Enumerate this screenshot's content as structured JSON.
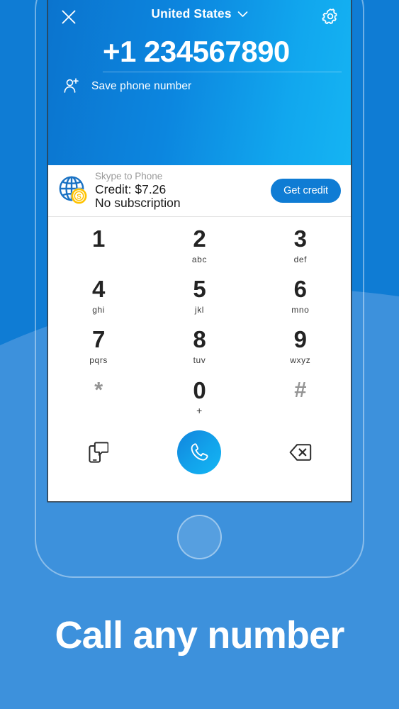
{
  "background": {
    "dark_blue": "#0F7CD4",
    "light_blue": "#3D91DC"
  },
  "phone": {
    "home_button_name": "home-button"
  },
  "app": {
    "header": {
      "close_icon": "close-icon",
      "country": "United States",
      "chevron_icon": "chevron-down-icon",
      "settings_icon": "gear-icon",
      "phone_number": "+1 234567890",
      "save_icon": "add-contact-icon",
      "save_label": "Save phone number",
      "gradient_from": "#0B74CE",
      "gradient_to": "#15B4F3"
    },
    "credit": {
      "icon": "globe-coin-icon",
      "title": "Skype to Phone",
      "amount": "Credit: $7.26",
      "subscription": "No subscription",
      "button_label": "Get credit",
      "button_color": "#0F7CD4"
    },
    "keypad": {
      "keys": [
        {
          "digit": "1",
          "letters": ""
        },
        {
          "digit": "2",
          "letters": "abc"
        },
        {
          "digit": "3",
          "letters": "def"
        },
        {
          "digit": "4",
          "letters": "ghi"
        },
        {
          "digit": "5",
          "letters": "jkl"
        },
        {
          "digit": "6",
          "letters": "mno"
        },
        {
          "digit": "7",
          "letters": "pqrs"
        },
        {
          "digit": "8",
          "letters": "tuv"
        },
        {
          "digit": "9",
          "letters": "wxyz"
        },
        {
          "digit": "*",
          "letters": ""
        },
        {
          "digit": "0",
          "letters": "+"
        },
        {
          "digit": "#",
          "letters": ""
        }
      ]
    },
    "actions": {
      "sms_icon": "phone-message-icon",
      "call_icon": "phone-handset-icon",
      "backspace_icon": "backspace-icon",
      "call_button_color": "#12A3EB"
    }
  },
  "caption": "Call any number"
}
